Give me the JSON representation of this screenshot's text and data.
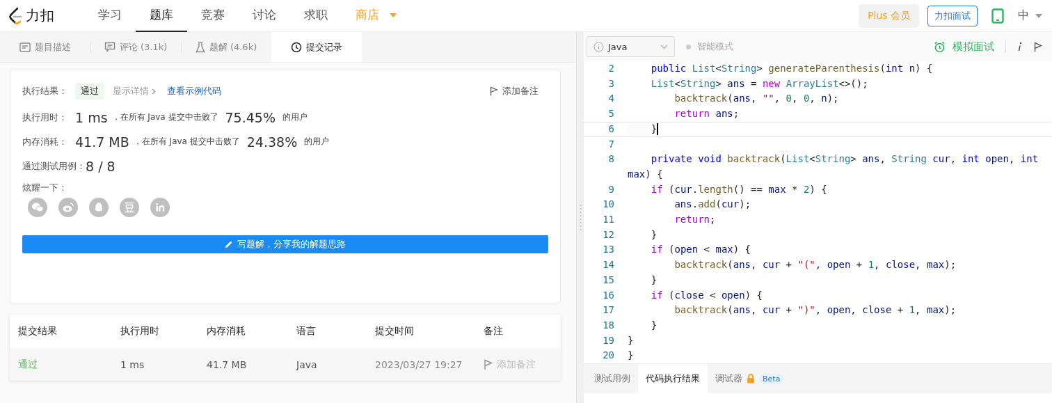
{
  "nav": {
    "logo": "力扣",
    "items": [
      {
        "label": "学习",
        "selected": false,
        "kind": "normal"
      },
      {
        "label": "题库",
        "selected": true,
        "kind": "normal"
      },
      {
        "label": "竞赛",
        "selected": false,
        "kind": "normal"
      },
      {
        "label": "讨论",
        "selected": false,
        "kind": "normal"
      },
      {
        "label": "求职",
        "selected": false,
        "kind": "normal"
      },
      {
        "label": "商店",
        "selected": false,
        "kind": "store"
      }
    ],
    "plus": "Plus 会员",
    "interview": "力扣面试",
    "language": "中"
  },
  "left_tabs": [
    {
      "label": "题目描述",
      "selected": false
    },
    {
      "label": "评论 (3.1k)",
      "selected": false
    },
    {
      "label": "题解 (4.6k)",
      "selected": false
    },
    {
      "label": "提交记录",
      "selected": true
    }
  ],
  "result": {
    "label": "执行结果：",
    "status": "通过",
    "details": "显示详情",
    "sample_link": "查看示例代码",
    "note_button": "添加备注"
  },
  "stats": [
    {
      "label": "执行用时：",
      "value": "1 ms",
      "text": "，在所有 Java 提交中击败了",
      "percent": "75.45%",
      "suffix": "的用户"
    },
    {
      "label": "内存消耗：",
      "value": "41.7 MB",
      "text": "，在所有 Java 提交中击败了",
      "percent": "24.38%",
      "suffix": "的用户"
    }
  ],
  "tests": {
    "label": "通过测试用例：",
    "value": "8 / 8"
  },
  "share": {
    "label": "炫耀一下："
  },
  "write_button": "写题解，分享我的解题思路",
  "table": {
    "columns": [
      "提交结果",
      "执行用时",
      "内存消耗",
      "语言",
      "提交时间",
      "备注"
    ],
    "rows": [
      {
        "status": "通过",
        "runtime": "1 ms",
        "memory": "41.7 MB",
        "language": "Java",
        "time": "2023/03/27 19:27",
        "note": "添加备注"
      }
    ]
  },
  "editor": {
    "language": "Java",
    "smart_mode": "智能模式",
    "mock_interview": "模拟面试",
    "lines": [
      {
        "number": "2",
        "active": false,
        "tokens": [
          {
            "kind": "kw",
            "text": "    public "
          },
          {
            "kind": "type",
            "text": "List"
          },
          {
            "kind": "p",
            "text": "<"
          },
          {
            "kind": "type",
            "text": "String"
          },
          {
            "kind": "p",
            "text": "> "
          },
          {
            "kind": "fn",
            "text": "generateParenthesis"
          },
          {
            "kind": "p",
            "text": "("
          },
          {
            "kind": "kw",
            "text": "int "
          },
          {
            "kind": "var",
            "text": "n"
          },
          {
            "kind": "p",
            "text": ") {"
          }
        ]
      },
      {
        "number": "3",
        "active": false,
        "tokens": [
          {
            "kind": "type",
            "text": "    List"
          },
          {
            "kind": "p",
            "text": "<"
          },
          {
            "kind": "type",
            "text": "String"
          },
          {
            "kind": "p",
            "text": "> "
          },
          {
            "kind": "var",
            "text": "ans"
          },
          {
            "kind": "p",
            "text": " = "
          },
          {
            "kind": "ctrl",
            "text": "new "
          },
          {
            "kind": "type",
            "text": "ArrayList"
          },
          {
            "kind": "p",
            "text": "<>();"
          }
        ]
      },
      {
        "number": "4",
        "active": false,
        "tokens": [
          {
            "kind": "fn",
            "text": "        backtrack"
          },
          {
            "kind": "p",
            "text": "("
          },
          {
            "kind": "var",
            "text": "ans"
          },
          {
            "kind": "p",
            "text": ", "
          },
          {
            "kind": "str",
            "text": "\"\""
          },
          {
            "kind": "p",
            "text": ", "
          },
          {
            "kind": "num",
            "text": "0"
          },
          {
            "kind": "p",
            "text": ", "
          },
          {
            "kind": "num",
            "text": "0"
          },
          {
            "kind": "p",
            "text": ", "
          },
          {
            "kind": "var",
            "text": "n"
          },
          {
            "kind": "p",
            "text": ");"
          }
        ]
      },
      {
        "number": "5",
        "active": false,
        "tokens": [
          {
            "kind": "ctrl",
            "text": "        return "
          },
          {
            "kind": "var",
            "text": "ans"
          },
          {
            "kind": "p",
            "text": ";"
          }
        ]
      },
      {
        "number": "6",
        "active": true,
        "tokens": [
          {
            "kind": "p",
            "text": "    }"
          }
        ]
      },
      {
        "number": "7",
        "active": false
      },
      {
        "number": "8",
        "active": false,
        "tokens": [
          {
            "kind": "kw",
            "text": "    private void "
          },
          {
            "kind": "fn",
            "text": "backtrack"
          },
          {
            "kind": "p",
            "text": "("
          },
          {
            "kind": "type",
            "text": "List"
          },
          {
            "kind": "p",
            "text": "<"
          },
          {
            "kind": "type",
            "text": "String"
          },
          {
            "kind": "p",
            "text": "> "
          },
          {
            "kind": "var",
            "text": "ans"
          },
          {
            "kind": "p",
            "text": ", "
          },
          {
            "kind": "type",
            "text": "String "
          },
          {
            "kind": "var",
            "text": "cur"
          },
          {
            "kind": "p",
            "text": ", "
          },
          {
            "kind": "kw",
            "text": "int "
          },
          {
            "kind": "var",
            "text": "open"
          },
          {
            "kind": "p",
            "text": ", "
          },
          {
            "kind": "kw",
            "text": "int "
          },
          {
            "kind": "var",
            "text": "max"
          },
          {
            "kind": "p",
            "text": ") {"
          }
        ]
      },
      {
        "number": "9",
        "active": false,
        "tokens": [
          {
            "kind": "ctrl",
            "text": "    if "
          },
          {
            "kind": "p",
            "text": "("
          },
          {
            "kind": "var",
            "text": "cur"
          },
          {
            "kind": "p",
            "text": "."
          },
          {
            "kind": "fn",
            "text": "length"
          },
          {
            "kind": "p",
            "text": "() == "
          },
          {
            "kind": "var",
            "text": "max"
          },
          {
            "kind": "p",
            "text": " * "
          },
          {
            "kind": "num",
            "text": "2"
          },
          {
            "kind": "p",
            "text": ") {"
          }
        ]
      },
      {
        "number": "10",
        "active": false,
        "tokens": [
          {
            "kind": "var",
            "text": "        ans"
          },
          {
            "kind": "p",
            "text": "."
          },
          {
            "kind": "fn",
            "text": "add"
          },
          {
            "kind": "p",
            "text": "("
          },
          {
            "kind": "var",
            "text": "cur"
          },
          {
            "kind": "p",
            "text": ");"
          }
        ]
      },
      {
        "number": "11",
        "active": false,
        "tokens": [
          {
            "kind": "ctrl",
            "text": "        return"
          },
          {
            "kind": "p",
            "text": ";"
          }
        ]
      },
      {
        "number": "12",
        "active": false,
        "tokens": [
          {
            "kind": "p",
            "text": "    }"
          }
        ]
      },
      {
        "number": "13",
        "active": false,
        "tokens": [
          {
            "kind": "ctrl",
            "text": "    if "
          },
          {
            "kind": "p",
            "text": "("
          },
          {
            "kind": "var",
            "text": "open"
          },
          {
            "kind": "p",
            "text": " < "
          },
          {
            "kind": "var",
            "text": "max"
          },
          {
            "kind": "p",
            "text": ") {"
          }
        ]
      },
      {
        "number": "14",
        "active": false,
        "tokens": [
          {
            "kind": "fn",
            "text": "        backtrack"
          },
          {
            "kind": "p",
            "text": "("
          },
          {
            "kind": "var",
            "text": "ans"
          },
          {
            "kind": "p",
            "text": ", "
          },
          {
            "kind": "var",
            "text": "cur"
          },
          {
            "kind": "p",
            "text": " + "
          },
          {
            "kind": "str",
            "text": "\"(\""
          },
          {
            "kind": "p",
            "text": ", "
          },
          {
            "kind": "var",
            "text": "open"
          },
          {
            "kind": "p",
            "text": " + "
          },
          {
            "kind": "num",
            "text": "1"
          },
          {
            "kind": "p",
            "text": ", "
          },
          {
            "kind": "var",
            "text": "close"
          },
          {
            "kind": "p",
            "text": ", "
          },
          {
            "kind": "var",
            "text": "max"
          },
          {
            "kind": "p",
            "text": ");"
          }
        ]
      },
      {
        "number": "15",
        "active": false,
        "tokens": [
          {
            "kind": "p",
            "text": "    }"
          }
        ]
      },
      {
        "number": "16",
        "active": false,
        "tokens": [
          {
            "kind": "ctrl",
            "text": "    if "
          },
          {
            "kind": "p",
            "text": "("
          },
          {
            "kind": "var",
            "text": "close"
          },
          {
            "kind": "p",
            "text": " < "
          },
          {
            "kind": "var",
            "text": "open"
          },
          {
            "kind": "p",
            "text": ") {"
          }
        ]
      },
      {
        "number": "17",
        "active": false,
        "tokens": [
          {
            "kind": "fn",
            "text": "        backtrack"
          },
          {
            "kind": "p",
            "text": "("
          },
          {
            "kind": "var",
            "text": "ans"
          },
          {
            "kind": "p",
            "text": ", "
          },
          {
            "kind": "var",
            "text": "cur"
          },
          {
            "kind": "p",
            "text": " + "
          },
          {
            "kind": "str",
            "text": "\")\""
          },
          {
            "kind": "p",
            "text": ", "
          },
          {
            "kind": "var",
            "text": "open"
          },
          {
            "kind": "p",
            "text": ", "
          },
          {
            "kind": "var",
            "text": "close"
          },
          {
            "kind": "p",
            "text": " + "
          },
          {
            "kind": "num",
            "text": "1"
          },
          {
            "kind": "p",
            "text": ", "
          },
          {
            "kind": "var",
            "text": "max"
          },
          {
            "kind": "p",
            "text": ");"
          }
        ]
      },
      {
        "number": "18",
        "active": false,
        "tokens": [
          {
            "kind": "p",
            "text": "    }"
          }
        ]
      },
      {
        "number": "19",
        "active": false,
        "tokens": [
          {
            "kind": "p",
            "text": "}"
          }
        ]
      },
      {
        "number": "20",
        "active": false,
        "tokens": [
          {
            "kind": "p",
            "text": "}"
          }
        ]
      }
    ]
  },
  "bottom_tabs": [
    {
      "label": "测试用例",
      "selected": false,
      "locked": false
    },
    {
      "label": "代码执行结果",
      "selected": true,
      "locked": false
    },
    {
      "label": "调试器",
      "selected": false,
      "locked": true,
      "badge": "Beta"
    }
  ]
}
